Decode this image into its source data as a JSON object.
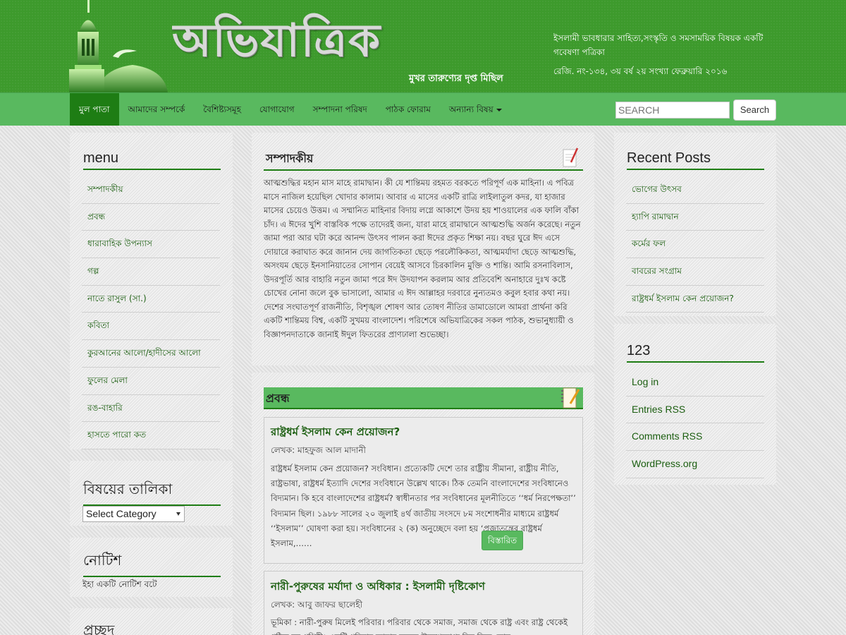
{
  "site": {
    "logo_text": "অভিযাত্রিক",
    "tagline": "মুখর তারুণ্যের দৃপ্ত মিছিল",
    "description": "ইসলামী ভাবধারার সাহিত্য,সংস্কৃতি ও সমসাময়িক বিষয়ক একটি গবেষণা পত্রিকা",
    "registration": "রেজি. নং-১৩৪, ৩য় বর্ষ ২য় সংখ্যা ফেব্রুয়ারি ২০১৬"
  },
  "nav": {
    "items": [
      {
        "label": "মুল পাতা",
        "active": true
      },
      {
        "label": "আমাদের সম্পর্কে"
      },
      {
        "label": "বৈশিষ্ট্যসমূহ"
      },
      {
        "label": "যোগাযোগ"
      },
      {
        "label": "সম্পাদনা পরিষদ"
      },
      {
        "label": "পাঠক ফোরাম"
      },
      {
        "label": "অন্যান্য বিষয়"
      }
    ],
    "search_placeholder": "SEARCH",
    "search_button": "Search"
  },
  "left": {
    "menu_title": "menu",
    "menu_items": [
      "সম্পাদকীয়",
      "প্রবন্ধ",
      "ধারাবাহিক উপন্যাস",
      "গল্প",
      "নাতে রাসুল (সা.)",
      "কবিতা",
      "কুরআনের আলো/হাদীসের আলো",
      "ফুলের মেলা",
      "রঙ-বাহারি",
      "হাসতে পারো কত"
    ],
    "category_title": "বিষয়ের তালিকা",
    "category_select": "Select Category",
    "notice_title": "নোটিশ",
    "notice_text": "ইহা একটি নোটিশ বটে",
    "cover_title": "প্রচ্ছদ"
  },
  "main": {
    "editorial_title": "সম্পাদকীয়",
    "editorial_text": "আত্মশুদ্ধির মহান মাস মাহে রামাদ্বান। কী যে শান্তিময় রহমত বরকতে পরিপূর্ণ এক মাহিনা। এ পবিত্র মাসে নাজিল হয়েছিল খোদার কালাম। আবার এ মাসের একটি রাত্রি লাইলাতুল কদর, যা হাজার মাসের চেয়েও উত্তম। এ সম্মানিত মাহিনার বিদায় লগ্নে আকাশে উদয় হয় শাওয়ালের এক ফালি বাঁকা চাঁদ। এ ঈদের খুশি বাস্তবিক পক্ষে তাদেরই জন্য, যারা মাহে রামাদ্বানে আত্মশুদ্ধি অর্জন করেছে। নতুন জামা পরা আর ঘটা করে আনন্দ উৎসব পালন করা ঈদের প্রকৃত শিক্ষা নয়। বছর ঘুরে ঈদ এসে দোয়ারে করাঘাত করে জানান দেয় জাগতিকতা ছেড়ে পরলৌকিকতা, আত্মমর্যাদা ছেড়ে আত্মশুদ্ধি, অসংযম ছেড়ে ইনসানিয়াতের সোপান বেয়েই আসবে চিরকালিন মুক্তি ও শান্তি। আমি রসনাবিলাস, উদরপূর্তি আর বাহারি নতুন জামা পরে ঈদ উদযাপন করলাম আর প্রতিবেশি অনাহারে দুঃখ কষ্টে চোখের নোনা জলে বুক ভাসালো, আমার এ ঈদ আল্লাহর দরবারে নুন্যতমও কবুল হবার কথা নয়। দেশের সংঘাতপূর্ণ রাজনীতি, বিশৃঙ্খল শোষণ আর তোষণ নীতির ডামাডোলে আমরা প্রার্থনা করি একটি শান্তিময় বিশ্ব, একটি সুখময় বাংলাদেশ। পরিশেষে অভিযাত্রিকের সকল পাঠক, শুভানুধ্যায়ী ও বিজ্ঞাপনদাতাকে জানাই ঈদুল ফিতরের প্রাণঢালা শুভেচ্ছা।",
    "articles_title": "প্রবন্ধ",
    "posts": [
      {
        "title": "রাষ্ট্রধর্ম ইসলাম কেন প্রয়োজন?",
        "author": "লেখক: মাহফুজ আল মাদানী",
        "excerpt": "রাষ্ট্রধর্ম ইসলাম কেন প্রয়োজন? সংবিধান। প্রত্যেকটি দেশে তার রাষ্ট্রীয় সীমানা, রাষ্ট্রীয় নীতি, রাষ্ট্রভাষা, রাষ্ট্রধর্ম ইত্যাদি দেশের সংবিধানে উল্লেখ থাকে। ঠিক তেমনি বাংলাদেশের সংবিধানেও বিদ্যমান। কি হবে বাংলাদেশের রাষ্ট্রধর্ম? স্বাধীনতার পর সংবিধানের মূলনীতিতে ‘‘ধর্ম নিরপেক্ষতা’’ বিদ্যমান ছিল। ১৯৮৮ সালের ২০ জুলাই ৪র্থ জাতীয় সংসদে ৮ম সংশোধনীর মাধ্যমে রাষ্ট্রধর্ম ‘‘ইসলাম’’ ঘোষণা করা হয়। সংবিধানের ২ (ক) অনুচ্ছেদে বলা হয় ‘প্রজাতন্ত্রের রাষ্ট্রধর্ম ইসলাম,……",
        "read_more": "বিস্তারিত"
      },
      {
        "title": "নারী-পুরুষের মর্যাদা ও অধিকার : ইসলামী দৃষ্টিকোণ",
        "author": "লেখক: আবু জাফর ছালেহী",
        "excerpt": "ভূমিকা : নারী-পুরুষ মিলেই পরিবার। পরিবার থেকে সমাজ, সমাজ থেকে রাষ্ট্র এবং রাষ্ট্র থেকেই গঠিত হয় পৃথিবী। একটি পরিবার আবার করতে উল্লেখযোগ্য দিক দিয়ে কোন"
      }
    ]
  },
  "right": {
    "recent_title": "Recent Posts",
    "recent_items": [
      "ভোগের উৎসব",
      "হ্যাপি রামাদ্বান",
      "কর্মের ফল",
      "বাবরের সংগ্রাম",
      "রাষ্ট্রধর্ম ইসলাম কেন প্রয়োজন?"
    ],
    "meta_title": "123",
    "meta_items": [
      "Log in",
      "Entries RSS",
      "Comments RSS",
      "WordPress.org"
    ]
  },
  "colors": {
    "header_green": "#3d9a2c",
    "nav_green": "#59b95f",
    "accent_dark_green": "#1e7d14"
  }
}
